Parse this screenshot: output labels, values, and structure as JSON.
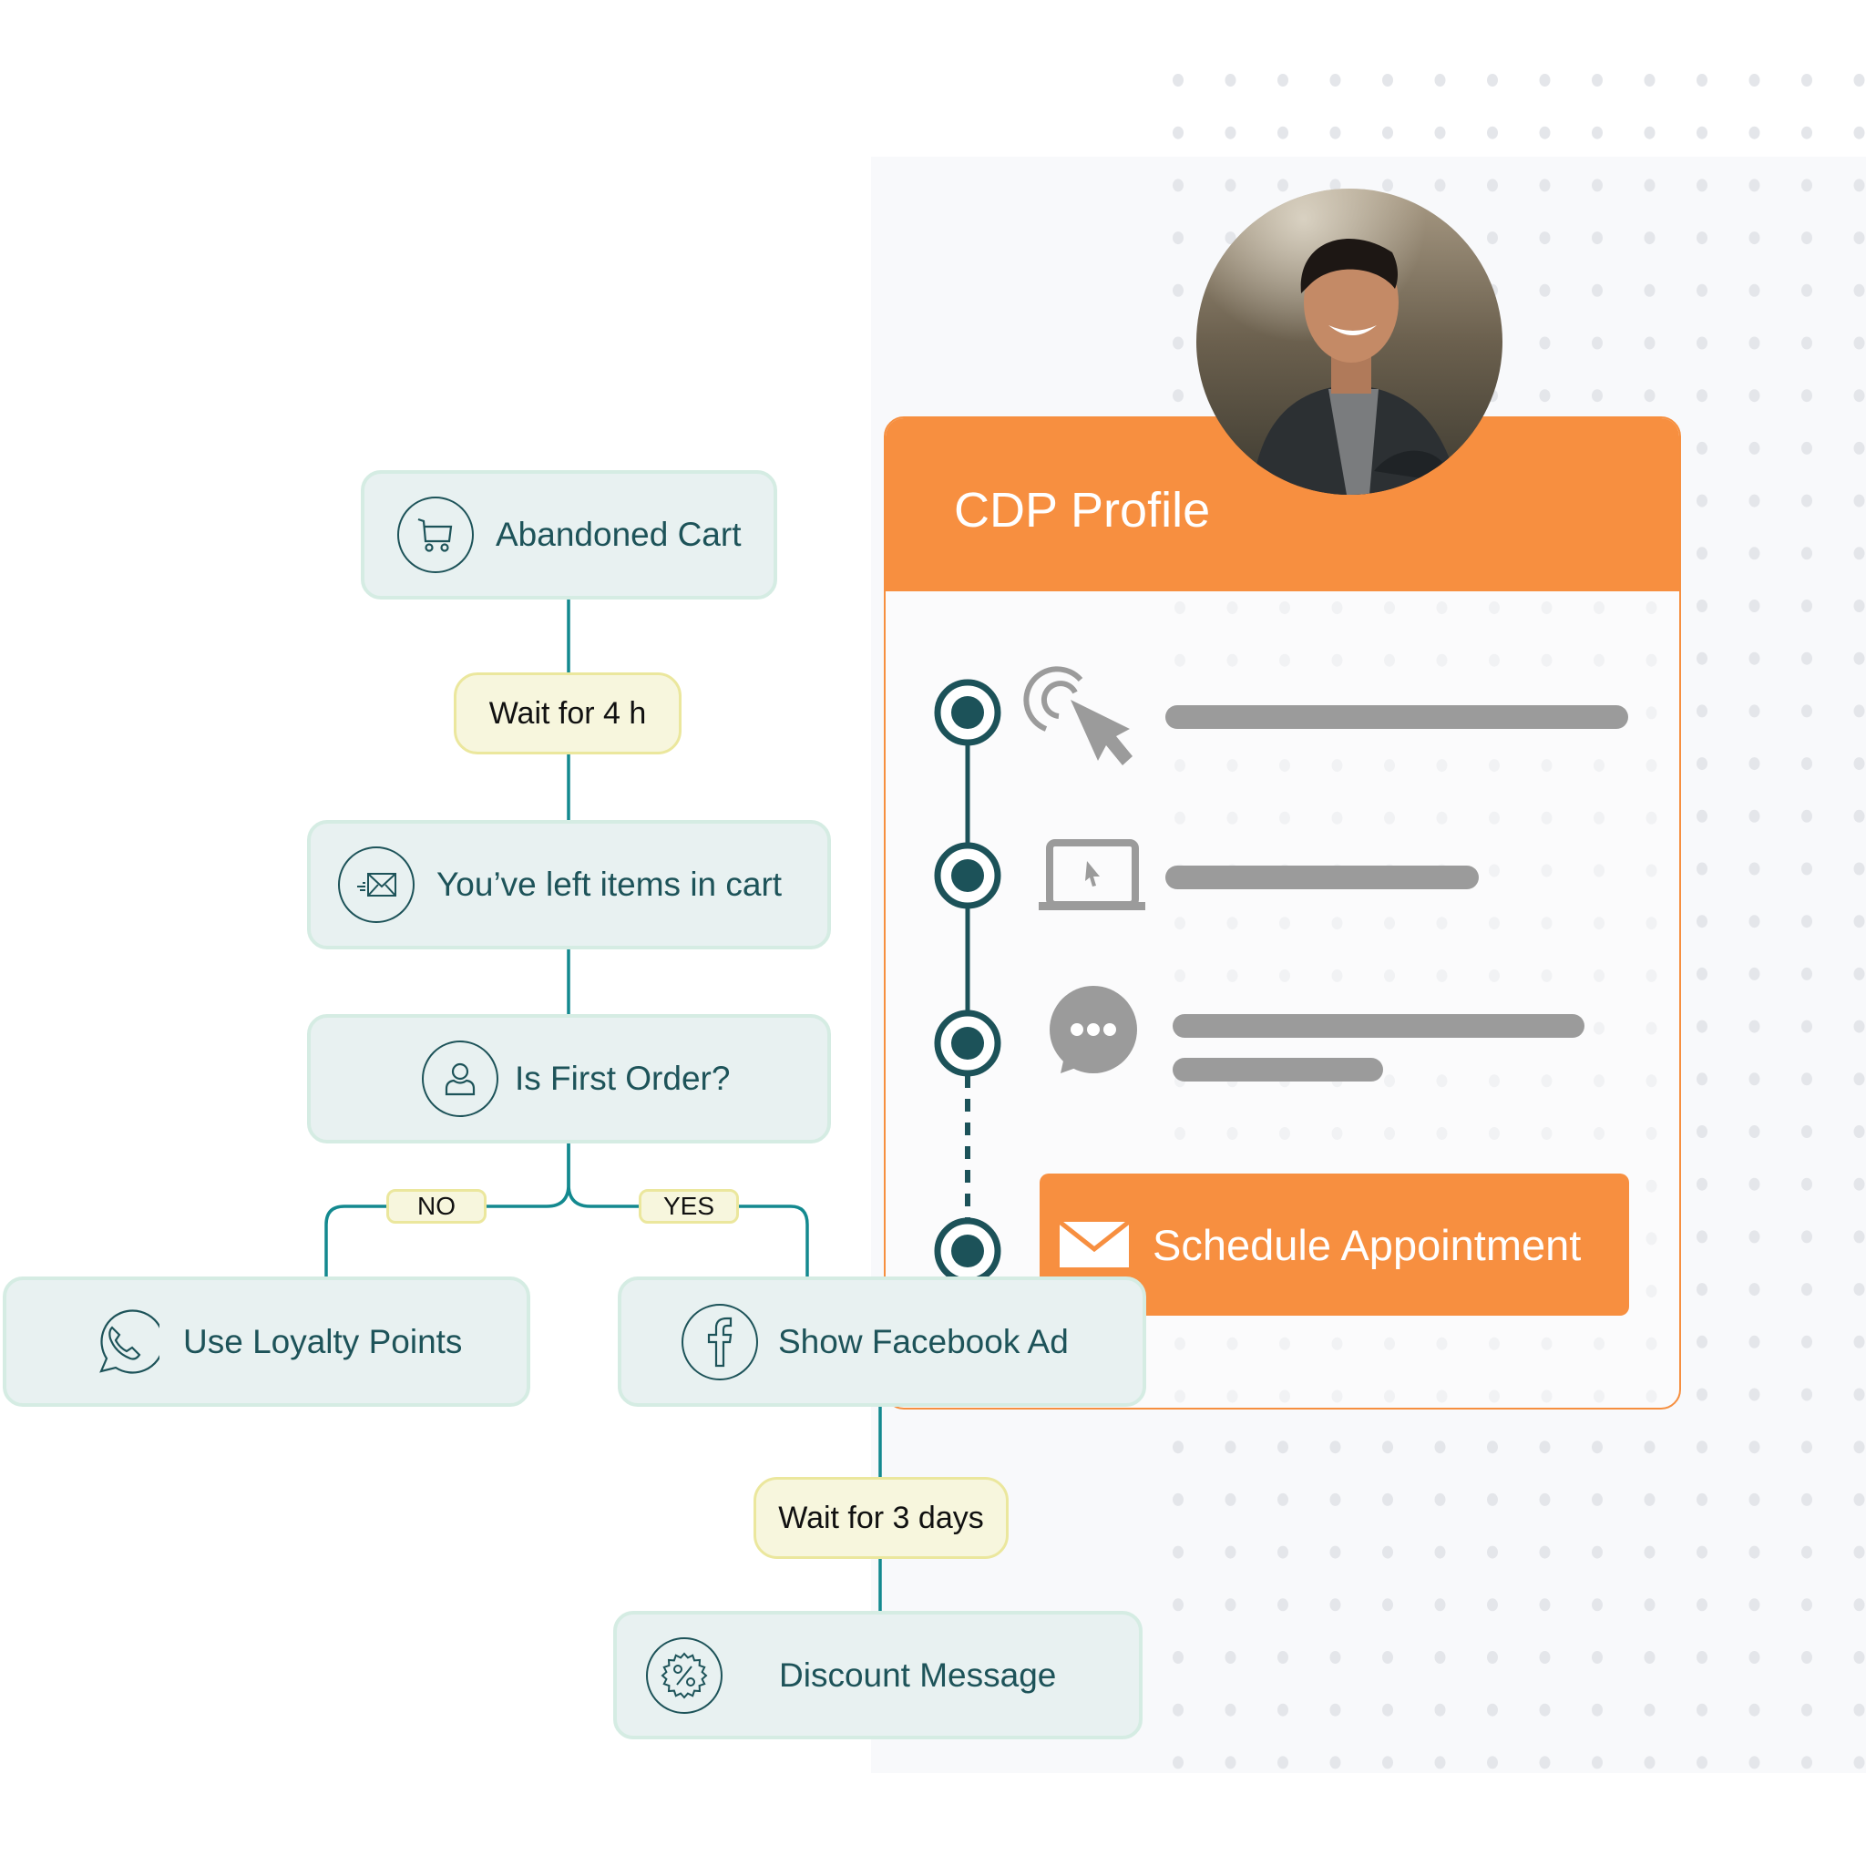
{
  "colors": {
    "teal_text": "#1d5359",
    "connector": "#13898f",
    "node_bg": "#e8f1f1",
    "node_border": "#d5ece3",
    "wait_bg": "#f7f6dd",
    "wait_border": "#ebe79d",
    "orange": "#f78f40",
    "timeline": "#1c5259",
    "placeholder_bar": "#9b9b9b"
  },
  "flow": {
    "nodes": [
      {
        "id": "abandoned-cart",
        "label": "Abandoned Cart",
        "icon": "shopping-cart-icon"
      },
      {
        "id": "wait-4h",
        "label": "Wait for 4 h",
        "type": "wait"
      },
      {
        "id": "left-items",
        "label": "You’ve left items in cart",
        "icon": "email-send-icon"
      },
      {
        "id": "first-order",
        "label": "Is First Order?",
        "icon": "user-icon"
      },
      {
        "id": "loyalty",
        "label": "Use Loyalty Points",
        "icon": "whatsapp-icon"
      },
      {
        "id": "facebook-ad",
        "label": "Show Facebook Ad",
        "icon": "facebook-icon"
      },
      {
        "id": "wait-3d",
        "label": "Wait for 3 days",
        "type": "wait"
      },
      {
        "id": "discount",
        "label": "Discount Message",
        "icon": "discount-badge-icon"
      }
    ],
    "branches": {
      "no": "NO",
      "yes": "YES"
    }
  },
  "profile": {
    "title": "CDP Profile",
    "avatar": "person-photo",
    "timeline": [
      {
        "icon": "click-cursor-icon",
        "bars": [
          1.0
        ]
      },
      {
        "icon": "laptop-cursor-icon",
        "bars": [
          0.68
        ]
      },
      {
        "icon": "chat-bubble-icon",
        "bars": [
          0.9,
          0.46
        ]
      }
    ],
    "action": {
      "label": "Schedule Appointment",
      "icon": "envelope-icon"
    }
  }
}
